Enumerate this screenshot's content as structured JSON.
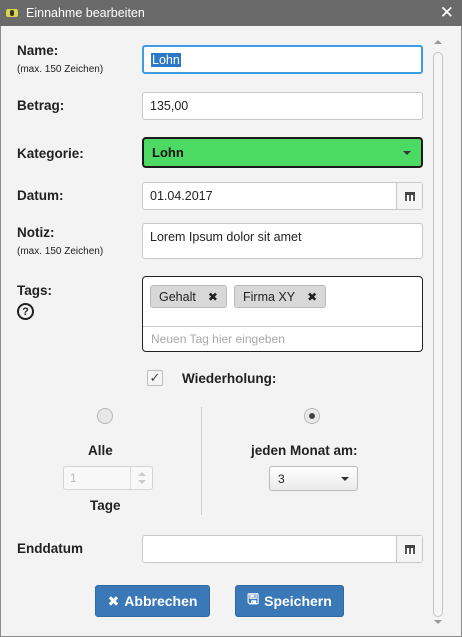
{
  "window": {
    "title": "Einnahme bearbeiten",
    "close_icon": "close-icon"
  },
  "form": {
    "name": {
      "label": "Name:",
      "hint": "(max. 150 Zeichen)",
      "value": "Lohn"
    },
    "betrag": {
      "label": "Betrag:",
      "value": "135,00"
    },
    "kategorie": {
      "label": "Kategorie:",
      "value": "Lohn",
      "color": "#4cd964"
    },
    "datum": {
      "label": "Datum:",
      "value": "01.04.2017"
    },
    "notiz": {
      "label": "Notiz:",
      "hint": "(max. 150 Zeichen)",
      "value": "Lorem Ipsum dolor sit amet"
    },
    "tags": {
      "label": "Tags:",
      "help": "?",
      "items": [
        {
          "label": "Gehalt",
          "remove": "✖"
        },
        {
          "label": "Firma XY",
          "remove": "✖"
        }
      ],
      "placeholder": "Neuen Tag hier eingeben"
    },
    "wiederholung": {
      "checkbox_mark": "✓",
      "label": "Wiederholung:",
      "left": {
        "label": "Alle",
        "value": "1",
        "unit": "Tage"
      },
      "right": {
        "label": "jeden Monat am:",
        "value": "3"
      }
    },
    "enddatum": {
      "label": "Enddatum",
      "value": ""
    }
  },
  "buttons": {
    "cancel": {
      "label": "Abbrechen",
      "icon": "✖"
    },
    "save": {
      "label": "Speichern",
      "icon": "🖫"
    }
  },
  "colors": {
    "accent": "#3a78b8",
    "focus": "#3d9de0"
  }
}
